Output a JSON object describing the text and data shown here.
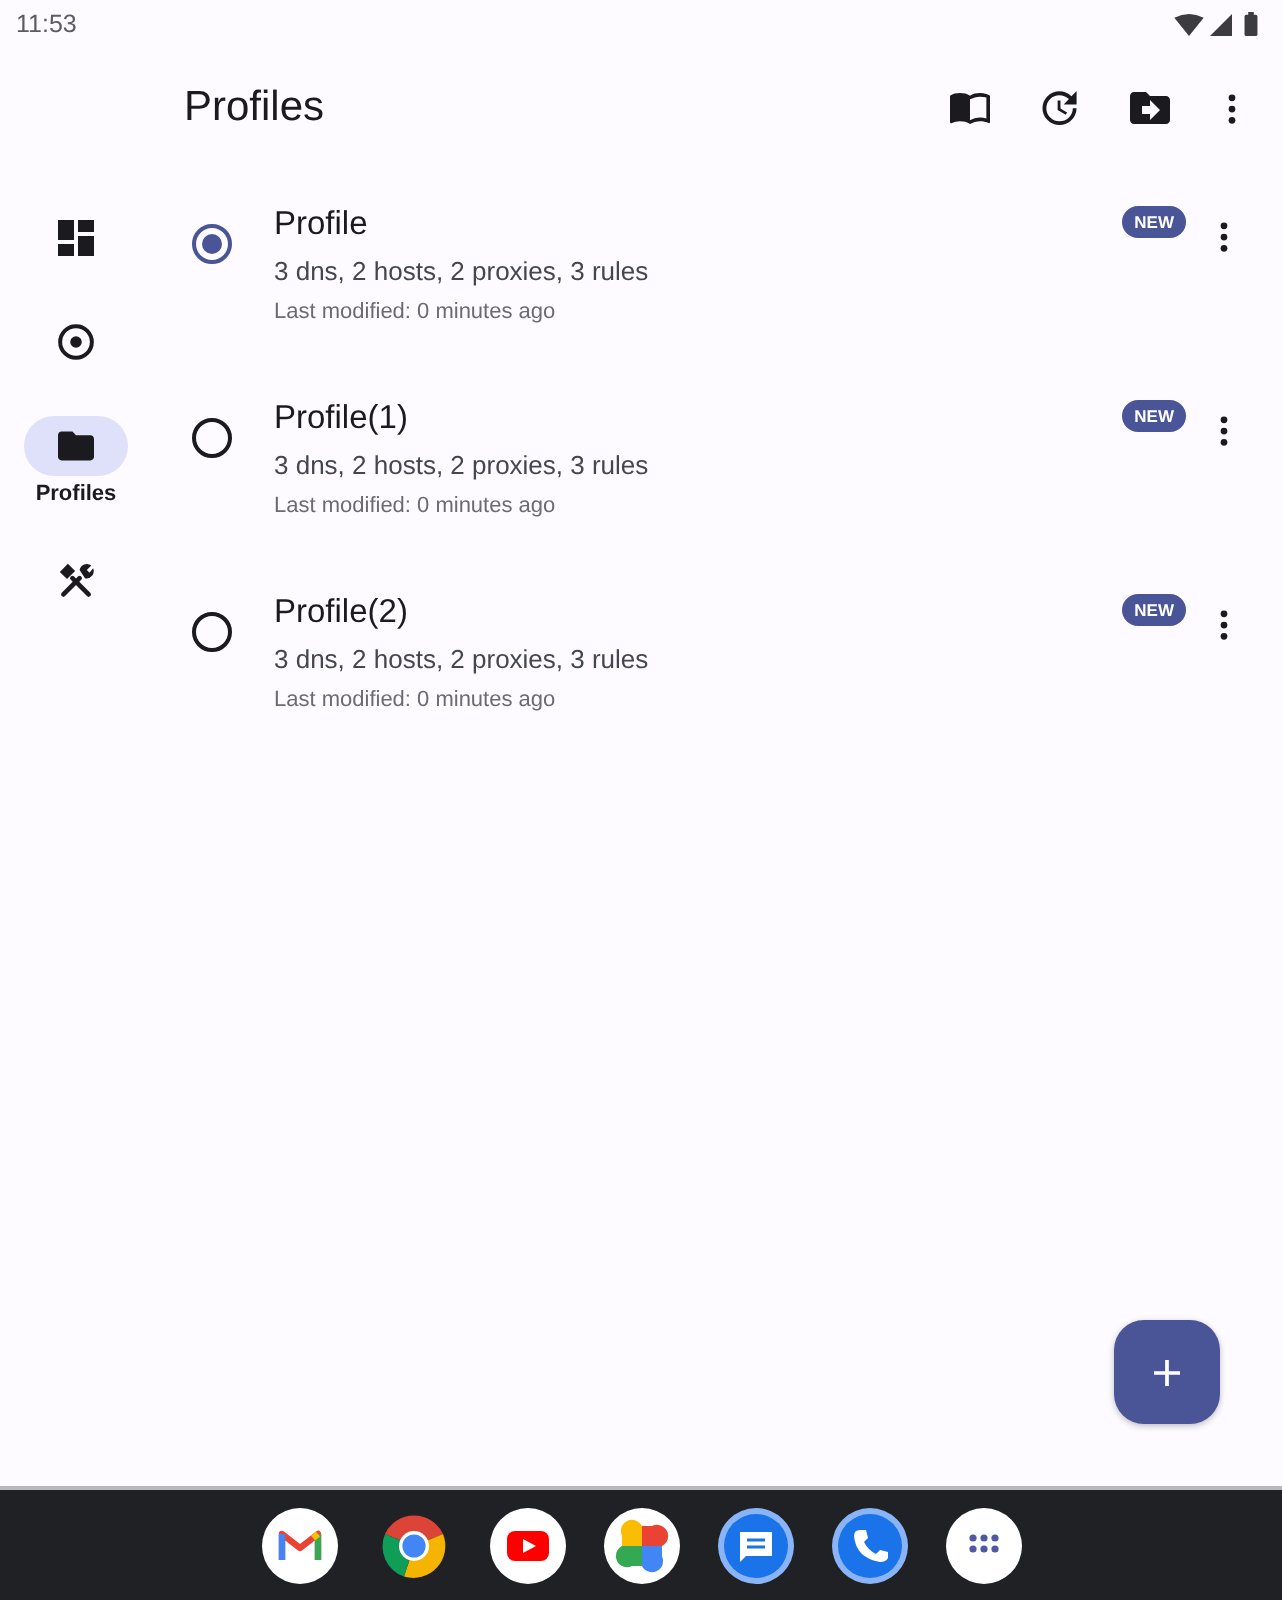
{
  "status_bar": {
    "time": "11:53"
  },
  "top_bar": {
    "title": "Profiles"
  },
  "nav_rail": {
    "items": [
      {
        "selected": false
      },
      {
        "selected": false
      },
      {
        "label": "Profiles",
        "selected": true
      },
      {
        "selected": false
      }
    ]
  },
  "profiles": [
    {
      "name": "Profile",
      "summary": "3 dns, 2 hosts, 2 proxies, 3 rules",
      "modified": "Last modified: 0 minutes ago",
      "badge": "NEW",
      "selected": true
    },
    {
      "name": "Profile(1)",
      "summary": "3 dns, 2 hosts, 2 proxies, 3 rules",
      "modified": "Last modified: 0 minutes ago",
      "badge": "NEW",
      "selected": false
    },
    {
      "name": "Profile(2)",
      "summary": "3 dns, 2 hosts, 2 proxies, 3 rules",
      "modified": "Last modified: 0 minutes ago",
      "badge": "NEW",
      "selected": false
    }
  ]
}
